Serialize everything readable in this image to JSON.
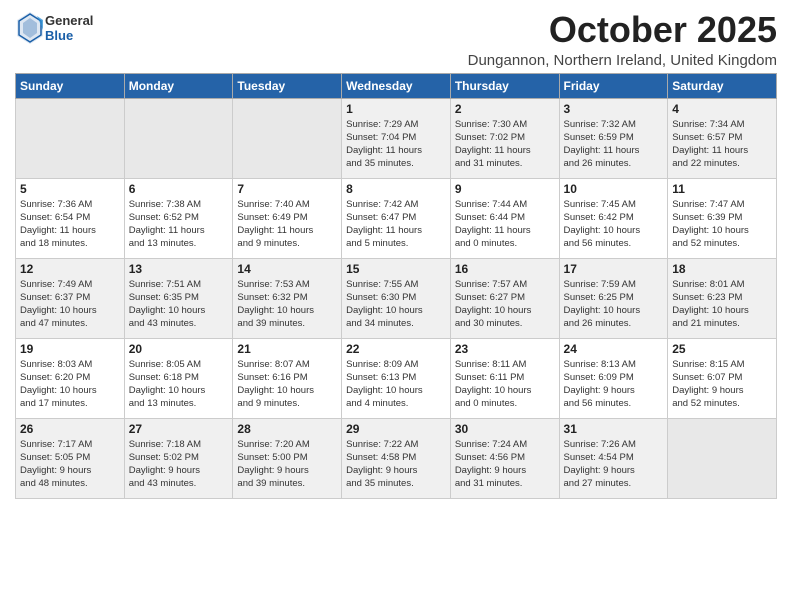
{
  "logo": {
    "general": "General",
    "blue": "Blue"
  },
  "title": "October 2025",
  "location": "Dungannon, Northern Ireland, United Kingdom",
  "weekdays": [
    "Sunday",
    "Monday",
    "Tuesday",
    "Wednesday",
    "Thursday",
    "Friday",
    "Saturday"
  ],
  "weeks": [
    [
      {
        "day": "",
        "info": ""
      },
      {
        "day": "",
        "info": ""
      },
      {
        "day": "",
        "info": ""
      },
      {
        "day": "1",
        "info": "Sunrise: 7:29 AM\nSunset: 7:04 PM\nDaylight: 11 hours\nand 35 minutes."
      },
      {
        "day": "2",
        "info": "Sunrise: 7:30 AM\nSunset: 7:02 PM\nDaylight: 11 hours\nand 31 minutes."
      },
      {
        "day": "3",
        "info": "Sunrise: 7:32 AM\nSunset: 6:59 PM\nDaylight: 11 hours\nand 26 minutes."
      },
      {
        "day": "4",
        "info": "Sunrise: 7:34 AM\nSunset: 6:57 PM\nDaylight: 11 hours\nand 22 minutes."
      }
    ],
    [
      {
        "day": "5",
        "info": "Sunrise: 7:36 AM\nSunset: 6:54 PM\nDaylight: 11 hours\nand 18 minutes."
      },
      {
        "day": "6",
        "info": "Sunrise: 7:38 AM\nSunset: 6:52 PM\nDaylight: 11 hours\nand 13 minutes."
      },
      {
        "day": "7",
        "info": "Sunrise: 7:40 AM\nSunset: 6:49 PM\nDaylight: 11 hours\nand 9 minutes."
      },
      {
        "day": "8",
        "info": "Sunrise: 7:42 AM\nSunset: 6:47 PM\nDaylight: 11 hours\nand 5 minutes."
      },
      {
        "day": "9",
        "info": "Sunrise: 7:44 AM\nSunset: 6:44 PM\nDaylight: 11 hours\nand 0 minutes."
      },
      {
        "day": "10",
        "info": "Sunrise: 7:45 AM\nSunset: 6:42 PM\nDaylight: 10 hours\nand 56 minutes."
      },
      {
        "day": "11",
        "info": "Sunrise: 7:47 AM\nSunset: 6:39 PM\nDaylight: 10 hours\nand 52 minutes."
      }
    ],
    [
      {
        "day": "12",
        "info": "Sunrise: 7:49 AM\nSunset: 6:37 PM\nDaylight: 10 hours\nand 47 minutes."
      },
      {
        "day": "13",
        "info": "Sunrise: 7:51 AM\nSunset: 6:35 PM\nDaylight: 10 hours\nand 43 minutes."
      },
      {
        "day": "14",
        "info": "Sunrise: 7:53 AM\nSunset: 6:32 PM\nDaylight: 10 hours\nand 39 minutes."
      },
      {
        "day": "15",
        "info": "Sunrise: 7:55 AM\nSunset: 6:30 PM\nDaylight: 10 hours\nand 34 minutes."
      },
      {
        "day": "16",
        "info": "Sunrise: 7:57 AM\nSunset: 6:27 PM\nDaylight: 10 hours\nand 30 minutes."
      },
      {
        "day": "17",
        "info": "Sunrise: 7:59 AM\nSunset: 6:25 PM\nDaylight: 10 hours\nand 26 minutes."
      },
      {
        "day": "18",
        "info": "Sunrise: 8:01 AM\nSunset: 6:23 PM\nDaylight: 10 hours\nand 21 minutes."
      }
    ],
    [
      {
        "day": "19",
        "info": "Sunrise: 8:03 AM\nSunset: 6:20 PM\nDaylight: 10 hours\nand 17 minutes."
      },
      {
        "day": "20",
        "info": "Sunrise: 8:05 AM\nSunset: 6:18 PM\nDaylight: 10 hours\nand 13 minutes."
      },
      {
        "day": "21",
        "info": "Sunrise: 8:07 AM\nSunset: 6:16 PM\nDaylight: 10 hours\nand 9 minutes."
      },
      {
        "day": "22",
        "info": "Sunrise: 8:09 AM\nSunset: 6:13 PM\nDaylight: 10 hours\nand 4 minutes."
      },
      {
        "day": "23",
        "info": "Sunrise: 8:11 AM\nSunset: 6:11 PM\nDaylight: 10 hours\nand 0 minutes."
      },
      {
        "day": "24",
        "info": "Sunrise: 8:13 AM\nSunset: 6:09 PM\nDaylight: 9 hours\nand 56 minutes."
      },
      {
        "day": "25",
        "info": "Sunrise: 8:15 AM\nSunset: 6:07 PM\nDaylight: 9 hours\nand 52 minutes."
      }
    ],
    [
      {
        "day": "26",
        "info": "Sunrise: 7:17 AM\nSunset: 5:05 PM\nDaylight: 9 hours\nand 48 minutes."
      },
      {
        "day": "27",
        "info": "Sunrise: 7:18 AM\nSunset: 5:02 PM\nDaylight: 9 hours\nand 43 minutes."
      },
      {
        "day": "28",
        "info": "Sunrise: 7:20 AM\nSunset: 5:00 PM\nDaylight: 9 hours\nand 39 minutes."
      },
      {
        "day": "29",
        "info": "Sunrise: 7:22 AM\nSunset: 4:58 PM\nDaylight: 9 hours\nand 35 minutes."
      },
      {
        "day": "30",
        "info": "Sunrise: 7:24 AM\nSunset: 4:56 PM\nDaylight: 9 hours\nand 31 minutes."
      },
      {
        "day": "31",
        "info": "Sunrise: 7:26 AM\nSunset: 4:54 PM\nDaylight: 9 hours\nand 27 minutes."
      },
      {
        "day": "",
        "info": ""
      }
    ]
  ]
}
